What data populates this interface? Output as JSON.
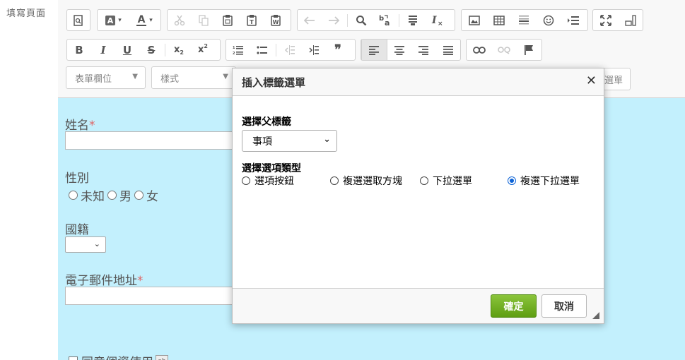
{
  "page": {
    "side_label": "填寫頁面"
  },
  "toolbar": {
    "combos": {
      "form_field": "表單欄位",
      "style": "樣式",
      "fragment": "選單"
    }
  },
  "form": {
    "name_label": "姓名",
    "required_mark": "*",
    "gender_label": "性別",
    "gender_options": [
      "未知",
      "男",
      "女"
    ],
    "nationality_label": "國籍",
    "email_label": "電子郵件地址",
    "agree_label": "同意個資使用"
  },
  "dialog": {
    "title": "插入標籤選單",
    "close_glyph": "✕",
    "parent_label": "選擇父標籤",
    "parent_value": "事項",
    "option_type_label": "選擇選項類型",
    "options": [
      "選項按鈕",
      "複選選取方塊",
      "下拉選單",
      "複選下拉選單"
    ],
    "selected_option": "複選下拉選單",
    "ok_label": "確定",
    "cancel_label": "取消"
  }
}
